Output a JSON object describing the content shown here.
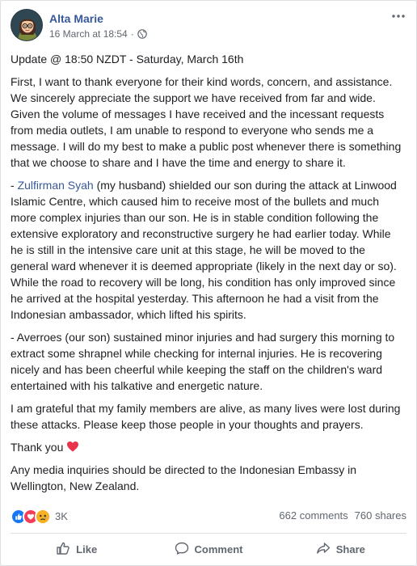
{
  "post": {
    "author": "Alta Marie",
    "timestamp": "16 March at 18:54",
    "separator": "·",
    "privacy_icon": "globe-icon",
    "more_icon": "more-options-icon",
    "update_line": "Update @ 18:50 NZDT - Saturday, March 16th",
    "para1": "First, I want to thank everyone for their kind words, concern, and assistance. We sincerely appreciate the support we have received from far and wide. Given the volume of messages I have received and the incessant requests from media outlets, I am unable to respond to everyone who sends me a message. I will do my best to make a public post whenever there is something that we choose to share and I have the time and energy to share it.",
    "para2_prefix": "- ",
    "para2_link": "Zulfirman Syah",
    "para2_rest": " (my husband) shielded our son during the attack at Linwood Islamic Centre, which caused him to receive most of the bullets and much more complex injuries than our son. He is in stable condition following the extensive exploratory and reconstructive surgery he had earlier today. While he is still in the intensive care unit at this stage, he will be moved to the general ward whenever it is deemed appropriate (likely in the next day or so). While the road to recovery will be long, his condition has only improved since he arrived at the hospital yesterday. This afternoon he had a visit from the Indonesian ambassador, which lifted his spirits.",
    "para3": "- Averroes (our son) sustained minor injuries and had surgery this morning to extract some shrapnel while checking for internal injuries. He is recovering nicely and has been cheerful while keeping the staff on the children's ward entertained with his talkative and energetic nature.",
    "para4": "I am grateful that my family members are alive, as many lives were lost during these attacks. Please keep those people in your thoughts and prayers.",
    "para5": "Thank you",
    "para6": "Any media inquiries should be directed to the Indonesian Embassy in Wellington, New Zealand."
  },
  "stats": {
    "reaction_icons": [
      "like-reaction-icon",
      "love-reaction-icon",
      "sad-reaction-icon"
    ],
    "reaction_count": "3K",
    "comments": "662 comments",
    "shares": "760 shares"
  },
  "actions": {
    "like": "Like",
    "comment": "Comment",
    "share": "Share"
  },
  "colors": {
    "link": "#385898",
    "like_blue": "#1877f2",
    "love_red": "#f33e58",
    "sad_yellow": "#f7b125"
  }
}
